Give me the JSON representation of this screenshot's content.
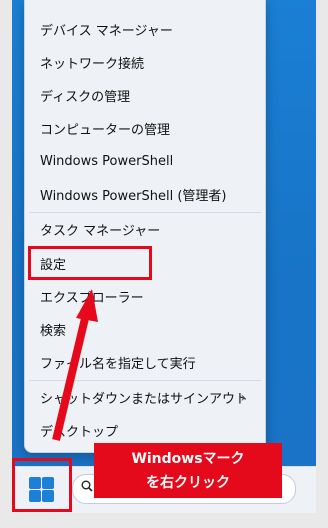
{
  "menu": {
    "items": [
      {
        "label": "デバイス マネージャー"
      },
      {
        "label": "ネットワーク接続"
      },
      {
        "label": "ディスクの管理"
      },
      {
        "label": "コンピューターの管理"
      },
      {
        "label": "Windows PowerShell"
      },
      {
        "label": "Windows PowerShell (管理者)"
      },
      {
        "label": "タスク マネージャー"
      },
      {
        "label": "設定"
      },
      {
        "label": "エクスプローラー"
      },
      {
        "label": "検索"
      },
      {
        "label": "ファイル名を指定して実行"
      },
      {
        "label": "シャットダウンまたはサインアウト"
      },
      {
        "label": "デスクトップ"
      }
    ],
    "submenu_chevron": "›"
  },
  "callout": {
    "line1": "Windowsマーク",
    "line2": "を右クリック"
  },
  "colors": {
    "highlight": "#e5091b",
    "windows_logo": "#1e7fd6"
  },
  "icons": {
    "start": "windows-logo-icon",
    "search": "search-icon"
  }
}
